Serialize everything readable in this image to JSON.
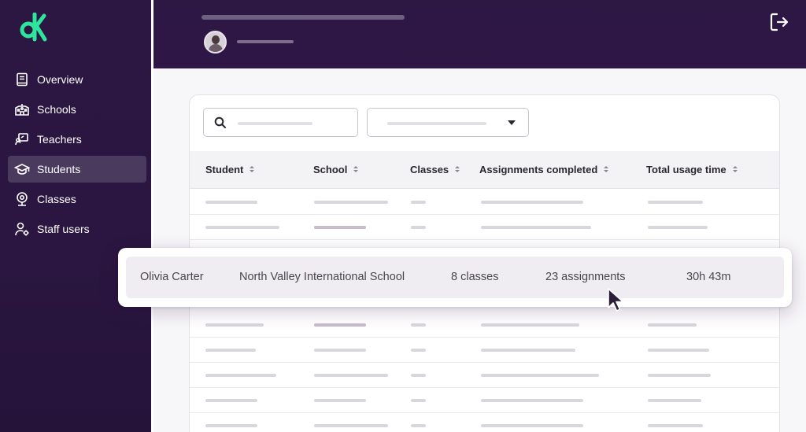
{
  "sidebar": {
    "items": [
      {
        "label": "Overview",
        "icon": "book-icon",
        "active": false
      },
      {
        "label": "Schools",
        "icon": "school-building-icon",
        "active": false
      },
      {
        "label": "Teachers",
        "icon": "teacher-board-icon",
        "active": false
      },
      {
        "label": "Students",
        "icon": "graduation-cap-icon",
        "active": true
      },
      {
        "label": "Classes",
        "icon": "webcam-icon",
        "active": false
      },
      {
        "label": "Staff users",
        "icon": "user-gear-icon",
        "active": false
      }
    ]
  },
  "header": {
    "logout_icon": "logout-icon"
  },
  "filters": {
    "search_icon": "search-icon",
    "select_icon": "chevron-down-icon"
  },
  "table": {
    "columns": [
      "Student",
      "School",
      "Classes",
      "Assignments completed",
      "Total usage time"
    ],
    "highlighted_row": {
      "student": "Olivia Carter",
      "school": "North Valley International School",
      "classes": "8 classes",
      "assignments": "23 assignments",
      "usage": "30h 43m"
    }
  },
  "colors": {
    "sidebar_bg": "#2c1742",
    "brand_green": "#2ee59d",
    "active_item_bg": "#4a3a5e"
  }
}
